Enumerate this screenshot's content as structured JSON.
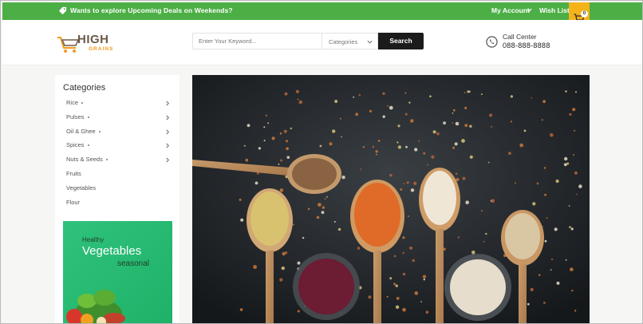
{
  "topbar": {
    "promo_text": "Wants to explore Upcoming Deals on Weekends?",
    "account_label": "My Account",
    "wishlist_label": "Wish List",
    "cart_count": "0",
    "bg_color": "#4caf45"
  },
  "header": {
    "logo_top": "HIGH",
    "logo_bottom": "GRAINS",
    "search": {
      "placeholder": "Enter Your Keyword...",
      "category_label": "Categories",
      "button_label": "Search"
    },
    "call": {
      "label": "Call Center",
      "number": "088-888-8888"
    }
  },
  "sidebar": {
    "title": "Categories",
    "items": [
      {
        "label": "Rice",
        "has_children": true
      },
      {
        "label": "Pulses",
        "has_children": true
      },
      {
        "label": "Oil & Ghee",
        "has_children": true
      },
      {
        "label": "Spices",
        "has_children": true
      },
      {
        "label": "Nuts & Seeds",
        "has_children": true
      },
      {
        "label": "Fruits",
        "has_children": false
      },
      {
        "label": "Vegetables",
        "has_children": false
      },
      {
        "label": "Flour",
        "has_children": false
      }
    ],
    "promo": {
      "line1": "Healthy",
      "line2": "Vegetables",
      "line3": "seasonal"
    }
  },
  "icons": [
    "tag-icon",
    "chevron-down-icon",
    "cart-icon",
    "phone-icon",
    "chevron-right-icon"
  ]
}
